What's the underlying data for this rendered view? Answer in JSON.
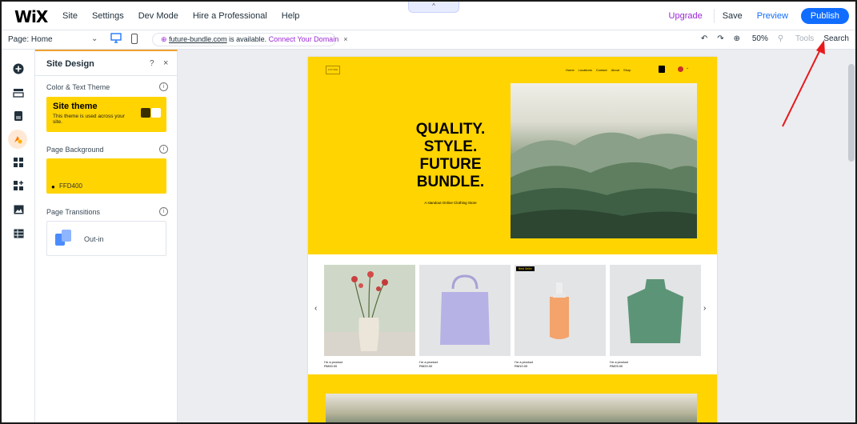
{
  "topbar": {
    "logo": "WiX",
    "menu": [
      "Site",
      "Settings",
      "Dev Mode",
      "Hire a Professional",
      "Help"
    ],
    "collapse_glyph": "^",
    "upgrade": "Upgrade",
    "save": "Save",
    "preview": "Preview",
    "publish": "Publish"
  },
  "subbar": {
    "page_label": "Page: Home",
    "domain_link": "future-bundle.com",
    "domain_text": " is available. ",
    "connect": "Connect Your Domain",
    "close": "×",
    "zoom": "50%",
    "tools": "Tools",
    "search": "Search"
  },
  "rail": {
    "icons": [
      "add-icon",
      "menus-icon",
      "pages-icon",
      "design-icon",
      "apps-icon",
      "widgets-icon",
      "media-icon",
      "table-icon"
    ]
  },
  "panel": {
    "title": "Site Design",
    "help": "?",
    "close": "×",
    "color_section": "Color & Text Theme",
    "theme_name": "Site theme",
    "theme_desc": "This theme is used across your site.",
    "bg_section": "Page Background",
    "bg_hex": "FFD400",
    "transitions_section": "Page Transitions",
    "transition_value": "Out-in"
  },
  "site": {
    "logo": "FUTURE",
    "nav": [
      "Home",
      "Locations",
      "Contact",
      "About",
      "Shop"
    ],
    "hero_lines": [
      "QUALITY.",
      "STYLE.",
      "FUTURE",
      "BUNDLE."
    ],
    "hero_sub": "A standout Online Clothing Store",
    "products": [
      {
        "name": "I'm a product",
        "price": "RM45.00"
      },
      {
        "name": "I'm a product",
        "price": "RM20.00"
      },
      {
        "name": "I'm a product",
        "price": "RM10.00",
        "badge": "Best Seller"
      },
      {
        "name": "I'm a product",
        "price": "RM25.00"
      }
    ]
  },
  "colors": {
    "brand_yellow": "#FFD400",
    "accent_blue": "#116DFF",
    "upgrade_purple": "#9A27D5",
    "annotation_red": "#E8191B"
  }
}
